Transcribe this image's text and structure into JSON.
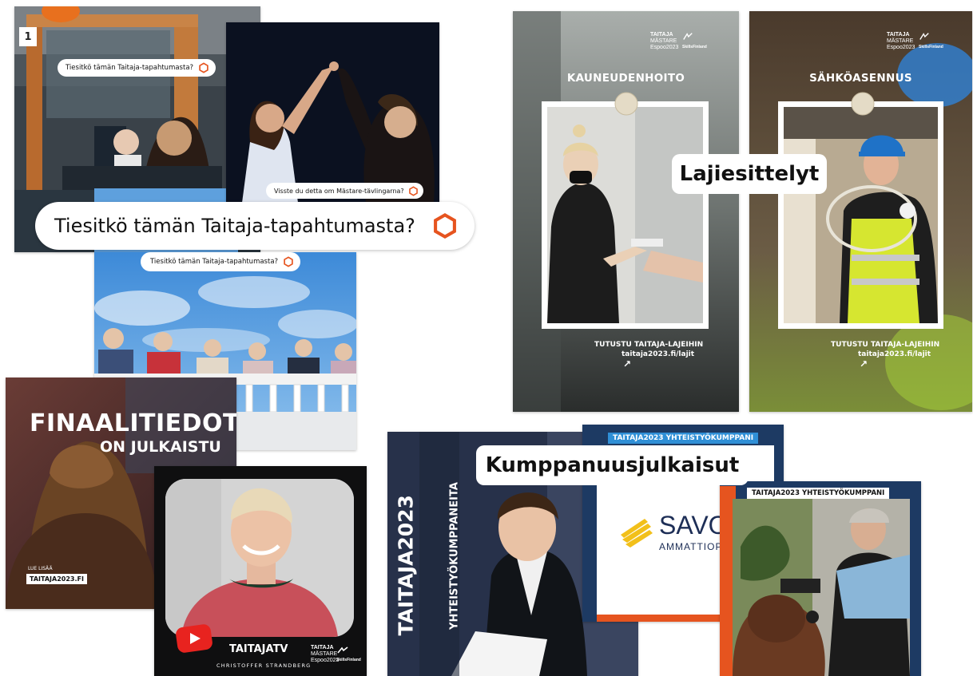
{
  "colors": {
    "orange": "#e6541f",
    "navy": "#1d3a63",
    "blue": "#2f8fd6",
    "dark": "#0c1220"
  },
  "tiesitko": {
    "badge_number": "1",
    "pill_small": "Tiesitkö tämän Taitaja-tapahtumasta?",
    "pill_sv": "Visste du detta om Mästare-tävlingarna?",
    "pill_large": "Tiesitkö tämän Taitaja-tapahtumasta?",
    "pill_sky": "Tiesitkö tämän Taitaja-tapahtumasta?"
  },
  "lajiesittelyt": {
    "overlay_label": "Lajiesittelyt",
    "brand_line1": "TAITAJA",
    "brand_line2": "MÄSTARE",
    "brand_line3": "Espoo2023",
    "brand_skills": "SkillsFinland",
    "posters": [
      {
        "title": "KAUNEUDENHOITO",
        "cta1": "TUTUSTU TAITAJA-LAJEIHIN",
        "cta2": "taitaja2023.fi/lajit",
        "arrow": "↗"
      },
      {
        "title": "SÄHKÖASENNUS",
        "cta1": "TUTUSTU TAITAJA-LAJEIHIN",
        "cta2": "taitaja2023.fi/lajit",
        "arrow": "↗"
      }
    ]
  },
  "finaali": {
    "title1": "FINAALITIEDOT",
    "title2": "ON JULKAISTU",
    "read_more": "LUE LISÄÄ",
    "url": "TAITAJA2023.FI"
  },
  "taitajatv": {
    "title": "TAITAJATV",
    "name": "CHRISTOFFER STRANDBERG"
  },
  "kumppanuus": {
    "overlay_label": "Kumppanuusjulkaisut",
    "vertical1": "TAITAJA2023",
    "vertical2": "YHTEISTYÖKUMPPANEITA",
    "partner_banner": "TAITAJA2023 YHTEISTYÖKUMPPANI",
    "savo_name": "SAVO",
    "savo_sub": "AMMATTIOP",
    "partner_banner2": "TAITAJA2023 YHTEISTYÖKUMPPANI"
  }
}
